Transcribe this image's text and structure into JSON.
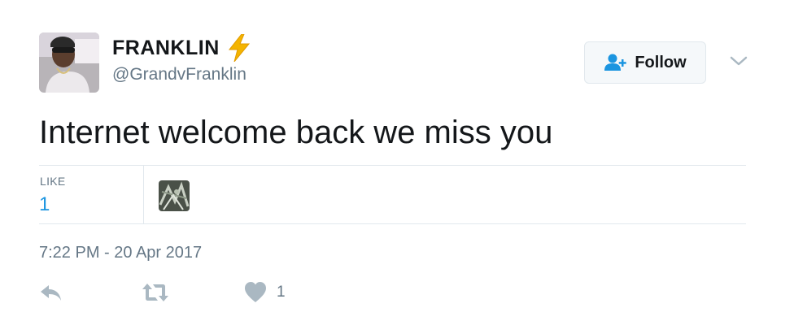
{
  "author": {
    "display_name": "FRANKLIN",
    "handle": "@GrandvFranklin",
    "avatar_icon": "profile-photo",
    "badge_icon": "lightning-bolt-emoji",
    "badge_color": "#f4b400"
  },
  "follow": {
    "label": "Follow",
    "icon": "add-user-icon",
    "icon_color": "#1b95e0"
  },
  "tweet": {
    "text": "Internet welcome back we miss you",
    "timestamp": "7:22 PM - 20 Apr 2017"
  },
  "stats": {
    "like_label": "LIKE",
    "like_count": "1",
    "liker_avatar_icon": "liker-avatar"
  },
  "actions": {
    "reply_icon": "reply-icon",
    "retweet_icon": "retweet-icon",
    "like_icon": "heart-icon",
    "like_count": "1",
    "icon_color": "#aab8c2"
  },
  "colors": {
    "link": "#1b95e0",
    "muted": "#657786",
    "border": "#e1e8ed"
  }
}
